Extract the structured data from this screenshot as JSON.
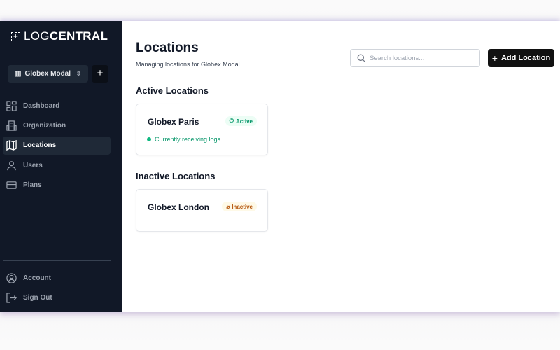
{
  "brand": {
    "light": "LOG",
    "bold": "CENTRAL"
  },
  "org": {
    "name": "Globex Modal",
    "add_label": "+"
  },
  "nav": [
    {
      "label": "Dashboard"
    },
    {
      "label": "Organization"
    },
    {
      "label": "Locations"
    },
    {
      "label": "Users"
    },
    {
      "label": "Plans"
    }
  ],
  "bottom": [
    {
      "label": "Account"
    },
    {
      "label": "Sign Out"
    }
  ],
  "page": {
    "title": "Locations",
    "subtitle": "Managing locations for Globex Modal",
    "search_placeholder": "Search locations...",
    "add_label": "Add Location"
  },
  "active": {
    "heading": "Active Locations",
    "cards": [
      {
        "name": "Globex Paris",
        "badge": "Active",
        "status": "Currently receiving logs"
      }
    ]
  },
  "inactive": {
    "heading": "Inactive Locations",
    "cards": [
      {
        "name": "Globex London",
        "badge": "Inactive"
      }
    ]
  },
  "colors": {
    "sidebar": "#111827",
    "active_green": "#059669",
    "inactive_amber": "#b45309"
  }
}
